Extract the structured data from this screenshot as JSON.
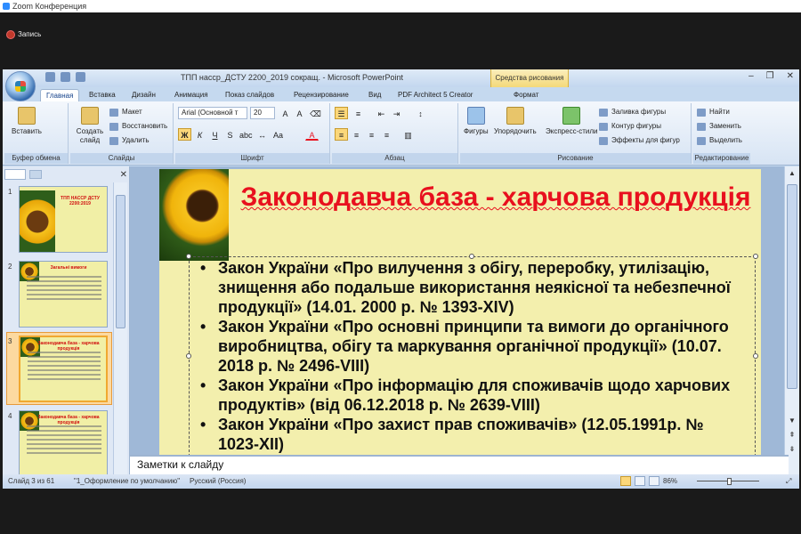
{
  "zoom": {
    "window_title": "Zoom Конференция",
    "recording_label": "Запись"
  },
  "ppt": {
    "window_title": "ТПП насср_ДСТУ 2200_2019 сокращ. - Microsoft PowerPoint",
    "tools_context": "Средства рисования",
    "tabs": [
      "Главная",
      "Вставка",
      "Дизайн",
      "Анимация",
      "Показ слайдов",
      "Рецензирование",
      "Вид",
      "PDF Architect 5 Creator",
      "Формат"
    ],
    "ribbon": {
      "clipboard": {
        "paste": "Вставить",
        "group": "Буфер обмена"
      },
      "slides": {
        "new_slide": "Создать слайд",
        "layout": "Макет",
        "reset": "Восстановить",
        "delete": "Удалить",
        "group": "Слайды"
      },
      "font": {
        "name": "Arial (Основной т",
        "size": "20",
        "group": "Шрифт"
      },
      "paragraph": {
        "group": "Абзац"
      },
      "drawing": {
        "shapes": "Фигуры",
        "arrange": "Упорядочить",
        "quick_styles": "Экспресс-стили",
        "fill": "Заливка фигуры",
        "outline": "Контур фигуры",
        "effects": "Эффекты для фигур",
        "group": "Рисование"
      },
      "editing": {
        "find": "Найти",
        "replace": "Заменить",
        "select": "Выделить",
        "group": "Редактирование"
      }
    },
    "thumbnails": [
      {
        "num": "1",
        "title": "ТПП НАССР ДСТУ 2200:2019"
      },
      {
        "num": "2",
        "title": "Загальні вимоги"
      },
      {
        "num": "3",
        "title": "Законодавча база - харчова продукція"
      },
      {
        "num": "4",
        "title": "Законодавча база - харчова продукція"
      }
    ],
    "slide": {
      "title": "Законодавча база - харчова продукція",
      "bullets": [
        "Закон України «Про вилучення з обігу, переробку, утилізацію, знищення або подальше використання неякісної та небезпечної продукції» (14.01. 2000 р. № 1393-XIV)",
        "Закон України «Про основні принципи та вимоги до органічного виробництва, обігу та маркування органічної продукції» (10.07. 2018 р. № 2496-VIII)",
        "Закон України «Про інформацію для споживачів щодо харчових продуктів» (від 06.12.2018 р. № 2639-VIII)",
        "Закон України «Про  захист прав споживачів» (12.05.1991р. № 1023-XII)"
      ]
    },
    "notes_placeholder": "Заметки к слайду",
    "status": {
      "slide_of": "Слайд 3 из 61",
      "theme": "\"1_Оформление по умолчанию\"",
      "language": "Русский (Россия)",
      "zoom": "86%"
    },
    "colors": {
      "title_red": "#e8101e",
      "slide_bg": "#f3efad",
      "ribbon_blue": "#c5d9ef"
    }
  }
}
